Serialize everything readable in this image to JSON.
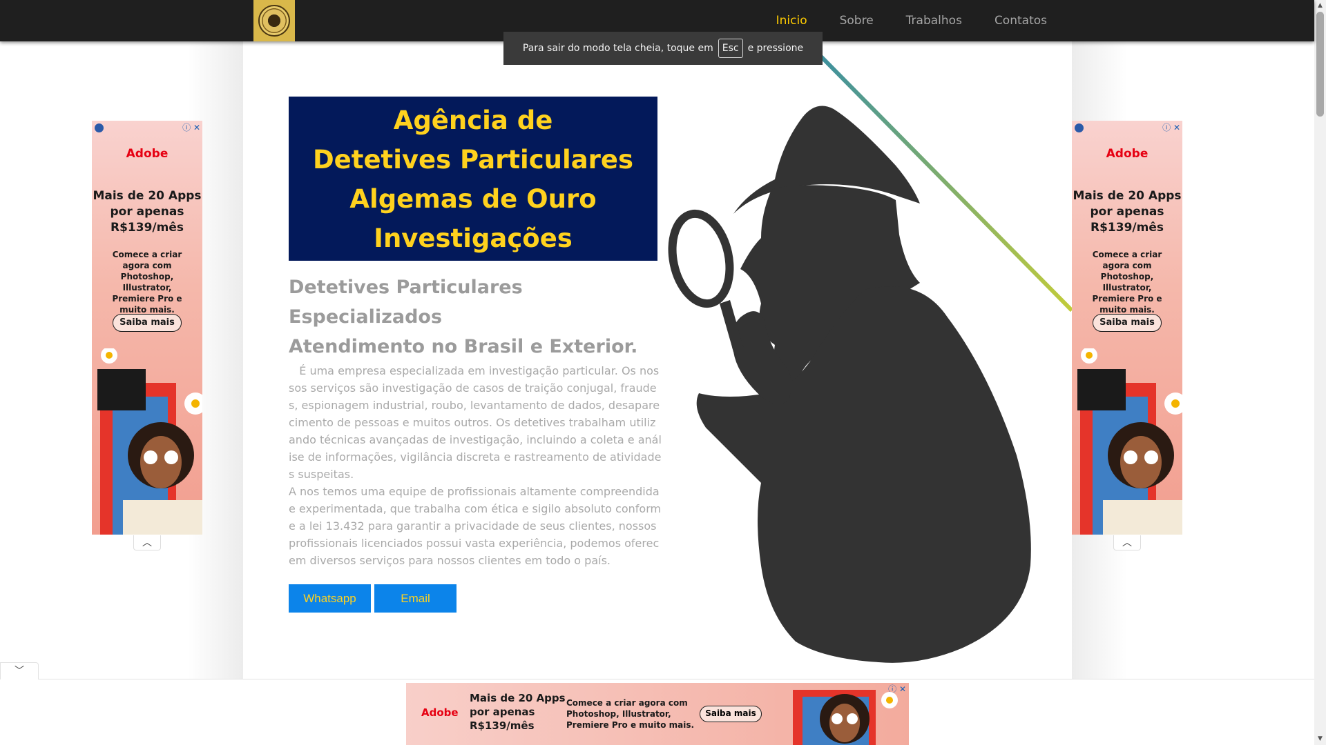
{
  "nav": {
    "items": [
      {
        "label": "Inicio",
        "active": true
      },
      {
        "label": "Sobre"
      },
      {
        "label": "Trabalhos"
      },
      {
        "label": "Contatos"
      }
    ]
  },
  "toast": {
    "before": "Para sair do modo tela cheia, toque em",
    "key": "Esc",
    "after": "e pressione"
  },
  "hero": {
    "title_lines": [
      "Agência de",
      "Detetives Particulares",
      "Algemas de Ouro",
      "Investigações"
    ],
    "subtitle_lines": [
      "Detetives Particulares Especializados",
      "Atendimento no Brasil e Exterior."
    ],
    "paragraph1": "   É uma empresa especializada em investigação particular. Os nossos serviços são investigação de casos de traição conjugal, fraudes, espionagem industrial, roubo, levantamento de dados, desaparecimento de pessoas e muitos outros. Os detetives trabalham utilizando técnicas avançadas de investigação, incluindo a coleta e análise de informações, vigilância discreta e rastreamento de atividades suspeitas.",
    "paragraph2": "A nos temos uma equipe de profissionais altamente compreendida e experimentada, que trabalha com ética e sigilo absoluto conforme a lei 13.432 para garantir a privacidade de seus clientes, nossos profissionais licenciados possui vasta experiência, podemos oferecem diversos serviços para nossos clientes em todo o país."
  },
  "buttons": {
    "whatsapp": "Whatsapp",
    "email": "Email"
  },
  "ad": {
    "brand": "Adobe",
    "headline_lines": [
      "Mais de 20 Apps",
      "por apenas",
      "R$139/mês"
    ],
    "description": "Comece a criar agora com Photoshop, Illustrator, Premiere Pro e muito mais.",
    "cta": "Saiba mais"
  },
  "colors": {
    "nav_bg": "#1f1f1f",
    "nav_active": "#ffcc00",
    "hero_bg": "#03195a",
    "hero_text": "#ffd21e",
    "button_bg": "#0c84ea",
    "silhouette": "#333333"
  },
  "icons": {
    "ad_close": "close-icon",
    "ad_info": "info-icon",
    "collapse": "chevron-down-icon",
    "expand": "chevron-up-icon"
  }
}
